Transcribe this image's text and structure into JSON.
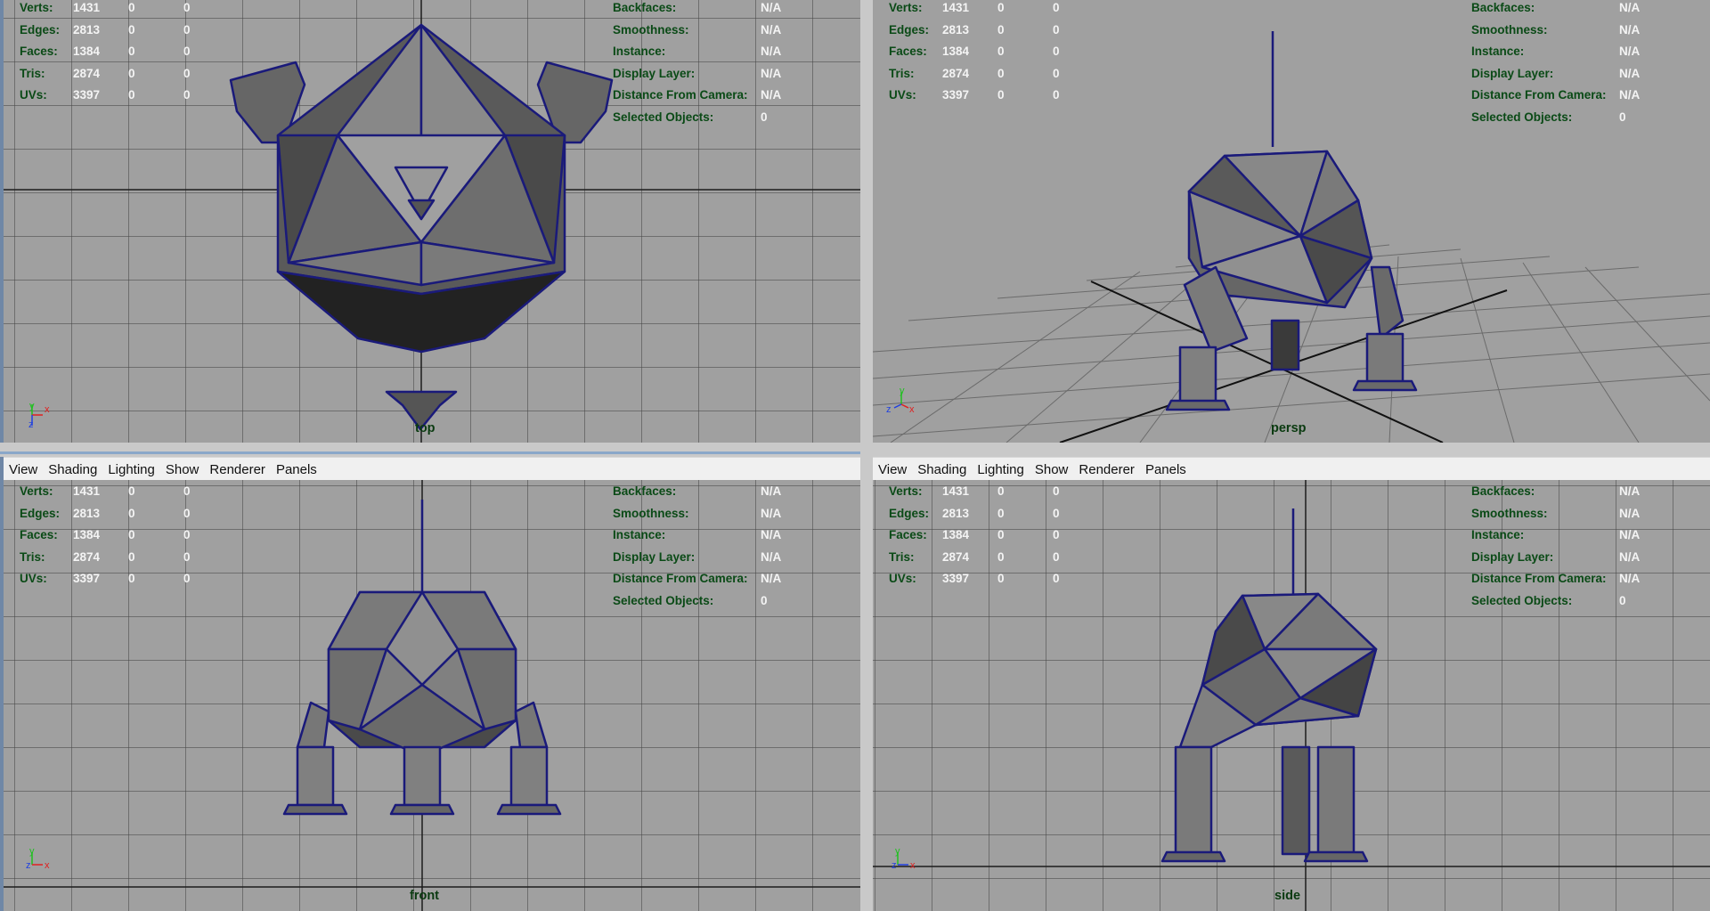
{
  "menu": [
    "View",
    "Shading",
    "Lighting",
    "Show",
    "Renderer",
    "Panels"
  ],
  "hud_stats": [
    {
      "label": "Verts:",
      "values": [
        "1431",
        "0",
        "0"
      ]
    },
    {
      "label": "Edges:",
      "values": [
        "2813",
        "0",
        "0"
      ]
    },
    {
      "label": "Faces:",
      "values": [
        "1384",
        "0",
        "0"
      ]
    },
    {
      "label": "Tris:",
      "values": [
        "2874",
        "0",
        "0"
      ]
    },
    {
      "label": "UVs:",
      "values": [
        "3397",
        "0",
        "0"
      ]
    }
  ],
  "hud_info": [
    {
      "label": "Backfaces:",
      "value": "N/A"
    },
    {
      "label": "Smoothness:",
      "value": "N/A"
    },
    {
      "label": "Instance:",
      "value": "N/A"
    },
    {
      "label": "Display Layer:",
      "value": "N/A"
    },
    {
      "label": "Distance From Camera:",
      "value": "N/A"
    },
    {
      "label": "Selected Objects:",
      "value": "0"
    }
  ],
  "cameras": {
    "top": "top",
    "persp": "persp",
    "front": "front",
    "side": "side"
  },
  "axis_letters": {
    "x": "x",
    "y": "y",
    "z": "z"
  },
  "colors": {
    "viewport_bg": "#a0a0a0",
    "hud_label": "#0a4a16",
    "hud_value": "#f4f4f4",
    "wireframe": "#1a1a7a",
    "axis_x": "#e02020",
    "axis_y": "#20c020",
    "axis_z": "#2040e0"
  }
}
